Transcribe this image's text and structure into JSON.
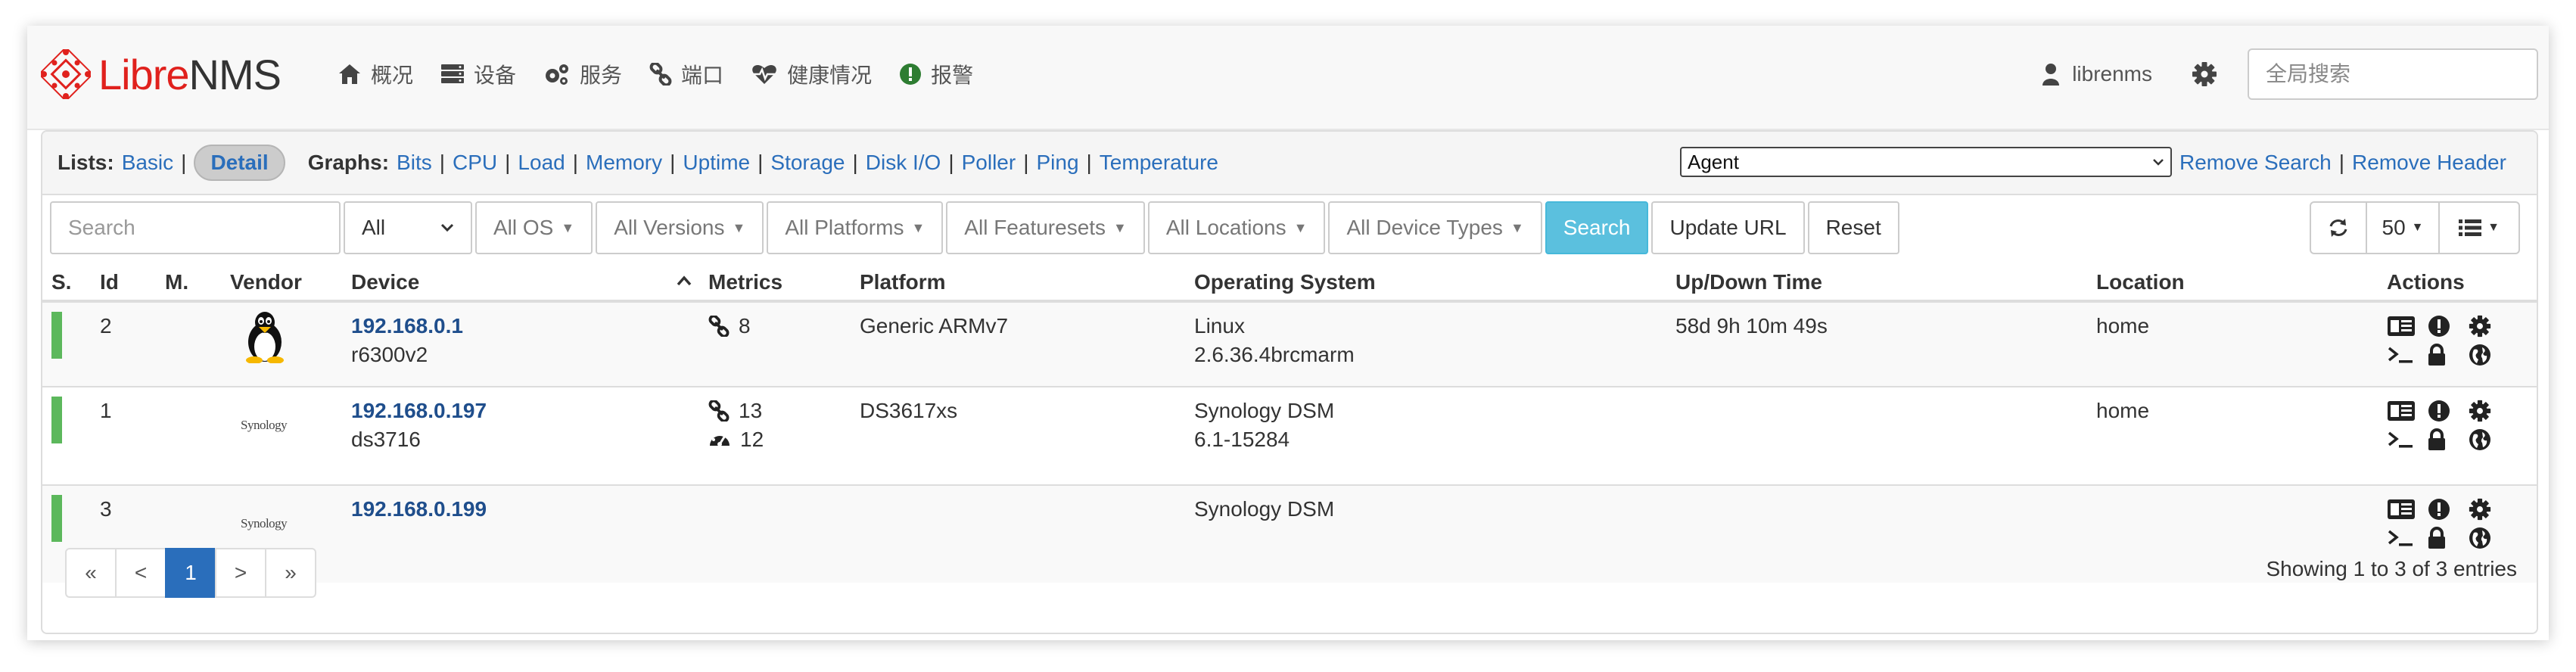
{
  "brand": {
    "libre": "Libre",
    "nms": "NMS"
  },
  "nav": [
    {
      "label": "概况",
      "icon": "home-icon"
    },
    {
      "label": "设备",
      "icon": "server-icon"
    },
    {
      "label": "服务",
      "icon": "cogs-icon"
    },
    {
      "label": "端口",
      "icon": "link-icon"
    },
    {
      "label": "健康情况",
      "icon": "heartbeat-icon"
    },
    {
      "label": "报警",
      "icon": "alert-icon"
    }
  ],
  "user": {
    "name": "librenms"
  },
  "global_search": {
    "placeholder": "全局搜索"
  },
  "lists": {
    "label": "Lists:",
    "basic": "Basic",
    "detail": "Detail",
    "graphs_label": "Graphs:",
    "graphs": [
      "Bits",
      "CPU",
      "Load",
      "Memory",
      "Uptime",
      "Storage",
      "Disk I/O",
      "Poller",
      "Ping",
      "Temperature"
    ]
  },
  "agent_select": {
    "value": "Agent"
  },
  "header_links": {
    "remove_search": "Remove Search",
    "remove_header": "Remove Header"
  },
  "filters": {
    "search_placeholder": "Search",
    "all": "All",
    "os": "All OS",
    "versions": "All Versions",
    "platforms": "All Platforms",
    "featuresets": "All Featuresets",
    "locations": "All Locations",
    "device_types": "All Device Types",
    "search_btn": "Search",
    "update_url": "Update URL",
    "reset": "Reset",
    "page_size": "50"
  },
  "columns": [
    "S.",
    "Id",
    "M.",
    "Vendor",
    "Device",
    "Metrics",
    "Platform",
    "Operating System",
    "Up/Down Time",
    "Location",
    "Actions"
  ],
  "rows": [
    {
      "id": "2",
      "vendor": "linux",
      "vendor_text": "",
      "ip": "192.168.0.1",
      "hostname": "r6300v2",
      "metric_ports": "8",
      "metric_sensors": "",
      "platform": "Generic ARMv7",
      "os": "Linux",
      "os_version": "2.6.36.4brcmarm",
      "uptime": "58d 9h 10m 49s",
      "location": "home"
    },
    {
      "id": "1",
      "vendor": "synology",
      "vendor_text": "Synology",
      "ip": "192.168.0.197",
      "hostname": "ds3716",
      "metric_ports": "13",
      "metric_sensors": "12",
      "platform": "DS3617xs",
      "os": "Synology DSM",
      "os_version": "6.1-15284",
      "uptime": "",
      "location": "home"
    },
    {
      "id": "3",
      "vendor": "synology",
      "vendor_text": "Synology",
      "ip": "192.168.0.199",
      "hostname": "",
      "metric_ports": "",
      "metric_sensors": "",
      "platform": "",
      "os": "Synology DSM",
      "os_version": "",
      "uptime": "",
      "location": ""
    }
  ],
  "pager": {
    "first": "«",
    "prev": "<",
    "current": "1",
    "next": ">",
    "last": "»"
  },
  "showing": "Showing 1 to 3 of 3 entries",
  "colors": {
    "status_up": "#5cb85c",
    "link": "#2a6ebb",
    "brand_red": "#e0211d",
    "search_btn": "#5bc0de"
  }
}
